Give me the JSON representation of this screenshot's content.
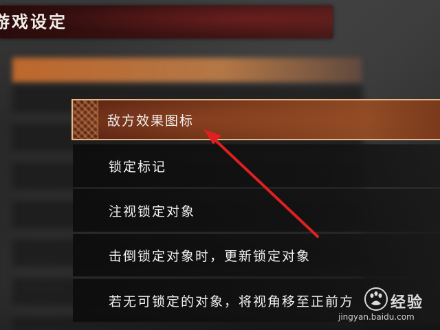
{
  "header": {
    "title": "游戏设定"
  },
  "dialog": {
    "options": [
      {
        "label": "敌方效果图标",
        "selected": true
      },
      {
        "label": "锁定标记",
        "selected": false
      },
      {
        "label": "注视锁定对象",
        "selected": false
      },
      {
        "label": "击倒锁定对象时，更新锁定对象",
        "selected": false
      },
      {
        "label": "若无可锁定的对象，将视角移至正前方",
        "selected": false
      }
    ]
  },
  "annotation": {
    "arrow_color": "#e02020"
  },
  "watermark": {
    "brand": "经验",
    "url": "jingyan.baidu.com"
  },
  "colors": {
    "selected_row": "#7a3a1c",
    "selected_border": "#e7b98a",
    "title_bar": "#3c1212"
  }
}
